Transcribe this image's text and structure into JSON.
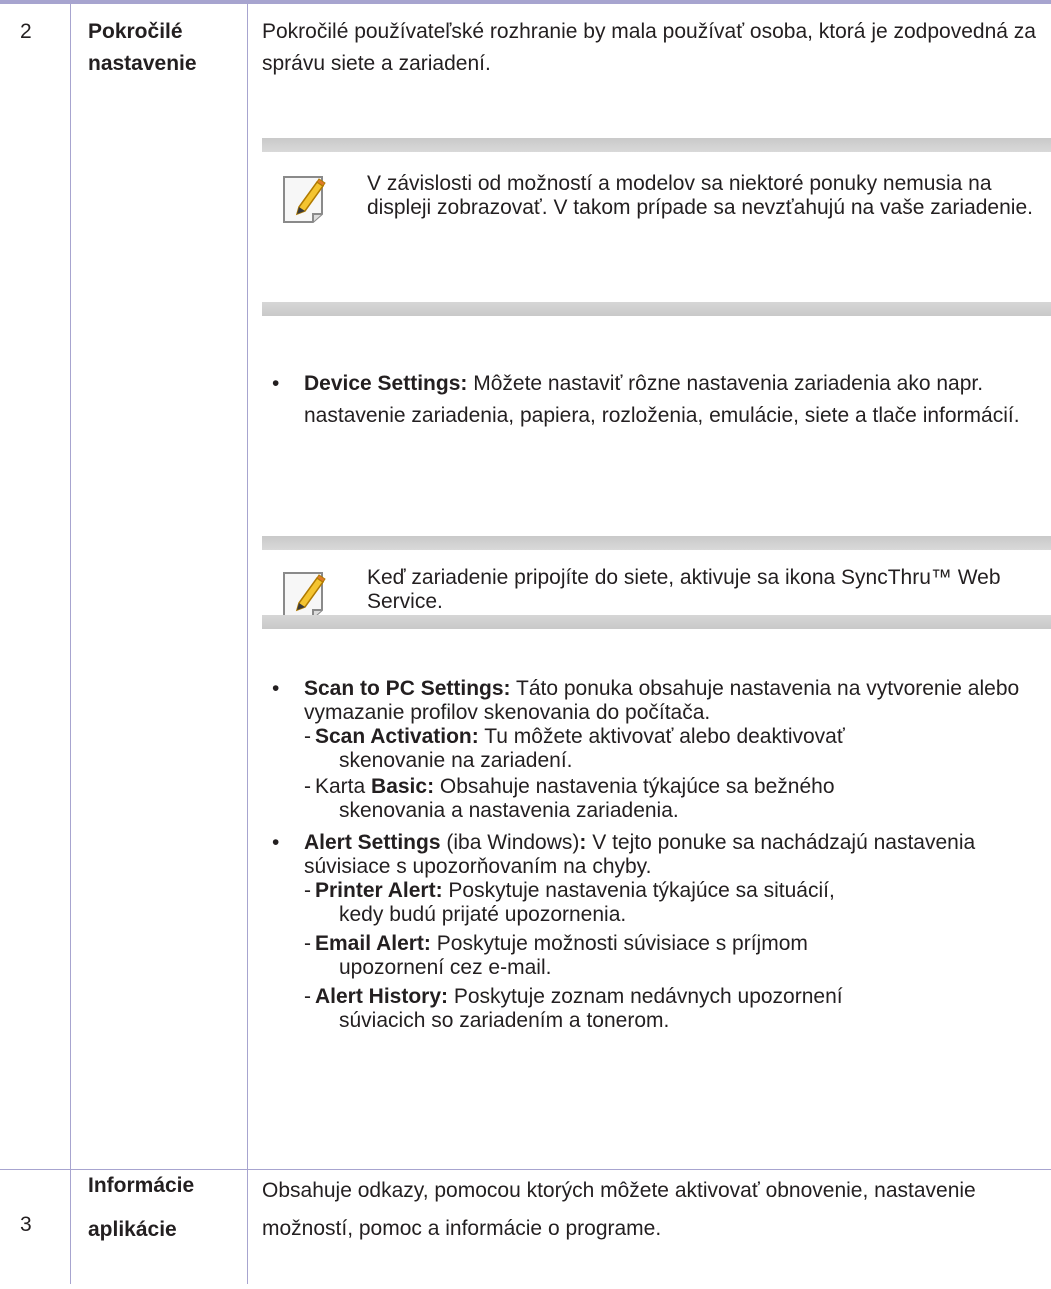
{
  "rows": [
    {
      "number": "2",
      "label_line1": "Pokročilé",
      "label_line2": "nastavenie",
      "intro": "Pokročilé používateľské rozhranie by mala používať osoba, ktorá je zodpovedná za správu siete a zariadení.",
      "note1": "V závislosti od možností a modelov sa niektoré ponuky nemusia na displeji zobrazovať. V takom prípade sa nevzťahujú na vaše zariadenie.",
      "device_settings": {
        "term": "Device Settings:",
        "text": " Môžete nastaviť rôzne nastavenia zariadenia ako napr. nastavenie zariadenia, papiera, rozloženia, emulácie, siete a tlače informácií."
      },
      "note2": "Keď zariadenie pripojíte do siete, aktivuje sa ikona SyncThru™ Web Service.",
      "scan_settings": {
        "term": "Scan to PC Settings:",
        "text": " Táto ponuka obsahuje nastavenia na vytvorenie alebo vymazanie profilov skenovania do počítača.",
        "scan_activation_term": "Scan Activation:",
        "scan_activation_text_line1": " Tu môžete aktivovať alebo deaktivovať",
        "scan_activation_text_line2": "skenovanie na zariadení.",
        "basic_prefix": "Karta ",
        "basic_term": "Basic:",
        "basic_text_line1": " Obsahuje nastavenia týkajúce sa bežného",
        "basic_text_line2": "skenovania a nastavenia zariadenia."
      },
      "alert_settings": {
        "term": "Alert Settings",
        "qualifier": " (iba Windows)",
        "colon": ":",
        "text": " V tejto ponuke sa nachádzajú nastavenia súvisiace s upozorňovaním na chyby.",
        "printer_term": "Printer Alert:",
        "printer_text_line1": " Poskytuje nastavenia týkajúce sa situácií,",
        "printer_text_line2": "kedy budú prijaté upozornenia.",
        "email_term": "Email Alert:",
        "email_text_line1": " Poskytuje možnosti súvisiace s príjmom",
        "email_text_line2": "upozornení cez e-mail.",
        "history_term": "Alert History:",
        "history_text_line1": " Poskytuje zoznam nedávnych upozornení",
        "history_text_line2": "súviacich so zariadením a tonerom."
      }
    },
    {
      "number": "3",
      "label_line1": "Informácie",
      "label_line2": "aplikácie",
      "description": "Obsahuje odkazy, pomocou ktorých môžete aktivovať obnovenie, nastavenie možností, pomoc a informácie o programe."
    }
  ],
  "glyphs": {
    "bullet": "•",
    "dash": "-"
  },
  "icons": {
    "note": "note-pencil-icon"
  }
}
